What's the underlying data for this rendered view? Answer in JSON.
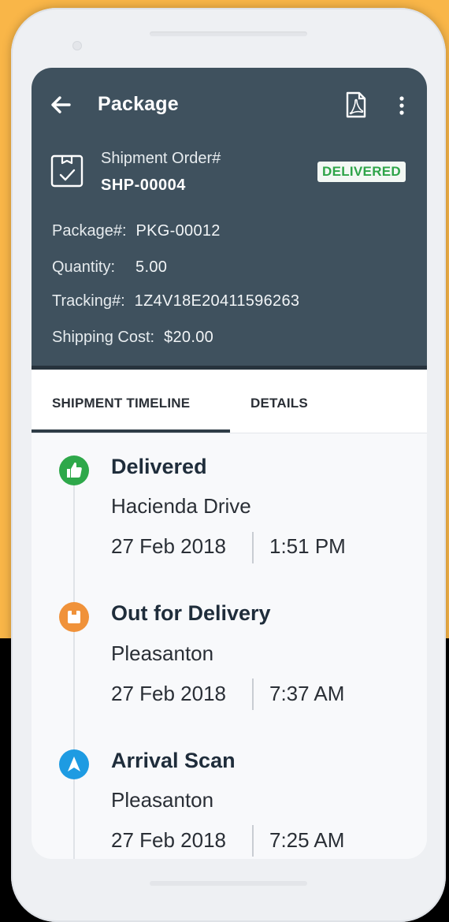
{
  "header": {
    "title": "Package",
    "icons": {
      "back": "back-arrow-icon",
      "pdf": "pdf-icon",
      "more": "more-vertical-icon",
      "order": "package-check-icon"
    },
    "order_label": "Shipment Order#",
    "order_number": "SHP-00004",
    "status_badge": "DELIVERED"
  },
  "details": {
    "package_label": "Package#:",
    "package_value": "PKG-00012",
    "quantity_label": "Quantity:",
    "quantity_value": "5.00",
    "tracking_label": "Tracking#:",
    "tracking_value": "1Z4V18E20411596263",
    "shipping_cost_label": "Shipping Cost:",
    "shipping_cost_value": "$20.00"
  },
  "tabs": [
    {
      "label": "SHIPMENT TIMELINE",
      "active": true
    },
    {
      "label": "DETAILS",
      "active": false
    }
  ],
  "timeline": [
    {
      "title": "Delivered",
      "place": "Hacienda Drive",
      "date": "27 Feb 2018",
      "time": "1:51 PM",
      "icon": "thumbs-up-icon",
      "color": "#2EA84A"
    },
    {
      "title": "Out for Delivery",
      "place": "Pleasanton",
      "date": "27 Feb 2018",
      "time": "7:37 AM",
      "icon": "box-icon",
      "color": "#F0923A"
    },
    {
      "title": "Arrival Scan",
      "place": "Pleasanton",
      "date": "27 Feb 2018",
      "time": "7:25 AM",
      "icon": "navigation-arrow-icon",
      "color": "#1E9BE2"
    }
  ],
  "colors": {
    "background_top": "#F9B648",
    "header": "#3F515E",
    "badge_text": "#2EA449"
  }
}
